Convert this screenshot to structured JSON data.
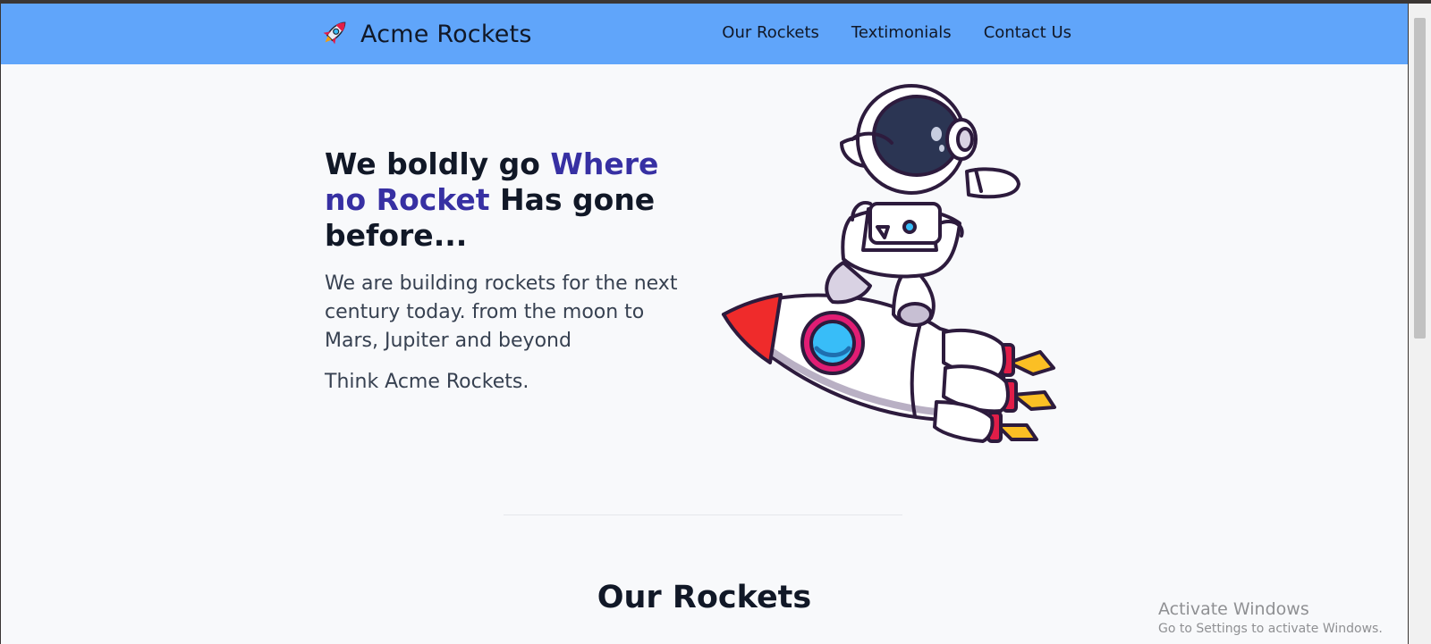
{
  "navbar": {
    "brand": "Acme Rockets",
    "brand_icon": "rocket-icon",
    "links": [
      "Our Rockets",
      "Textimonials",
      "Contact Us"
    ],
    "background": "#60a5fa"
  },
  "hero": {
    "title_part1": "We boldly go ",
    "title_accent": "Where no Rocket",
    "title_part2": " Has gone before...",
    "description": "We are building rockets for the next century today. from the moon to Mars, Jupiter and beyond",
    "tagline": "Think Acme Rockets.",
    "illustration": "astronaut-on-rocket-illustration",
    "accent_color": "#3730a3"
  },
  "sections": {
    "our_rockets_title": "Our Rockets"
  },
  "overlay": {
    "activate_title": "Activate Windows",
    "activate_subtitle": "Go to Settings to activate Windows."
  }
}
